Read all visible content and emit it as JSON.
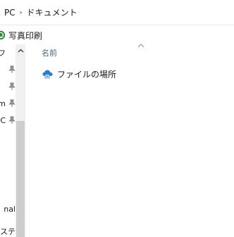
{
  "address": {
    "crumbs": [
      "PC",
      "ドキュメント"
    ],
    "separator": "›"
  },
  "toolbar": {
    "print_label": "写真印刷"
  },
  "nav": {
    "items": [
      {
        "text": "フ",
        "pinned": false
      },
      {
        "text": "",
        "pinned": true
      },
      {
        "text": "",
        "pinned": true
      },
      {
        "text": "m",
        "pinned": true
      },
      {
        "text": "C",
        "pinned": true
      }
    ],
    "bottom_items": [
      "nal",
      "ステ"
    ]
  },
  "content": {
    "column_name": "名前",
    "items": [
      {
        "name": "ファイルの場所",
        "icon": "cloud-folder-icon"
      }
    ]
  },
  "colors": {
    "accent": "#0078d7",
    "header_text": "#4c607a",
    "scroll_thumb": "#cdcdcd",
    "print_icon_green": "#2e8b3a"
  }
}
